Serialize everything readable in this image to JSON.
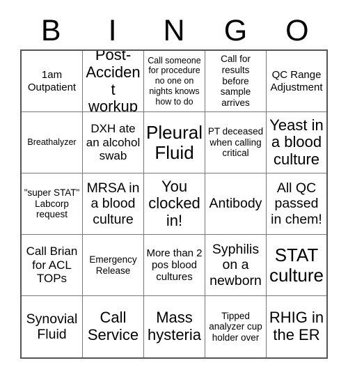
{
  "card": {
    "header_letters": [
      "B",
      "I",
      "N",
      "G",
      "O"
    ],
    "rows": [
      [
        {
          "text": "1am Outpatient",
          "size": "s"
        },
        {
          "text": "Post-Accident workup",
          "size": "xl"
        },
        {
          "text": "Call someone for procedure no one on nights knows how to do",
          "size": "xxs"
        },
        {
          "text": "Call for results before sample arrives",
          "size": "xs"
        },
        {
          "text": "QC Range Adjustment",
          "size": "s"
        }
      ],
      [
        {
          "text": "Breathalyzer",
          "size": "xxs"
        },
        {
          "text": "DXH ate an alcohol swab",
          "size": "m"
        },
        {
          "text": "Pleural Fluid",
          "size": "xxl"
        },
        {
          "text": "PT deceased when calling critical",
          "size": "xs"
        },
        {
          "text": "Yeast in a blood culture",
          "size": "xl"
        }
      ],
      [
        {
          "text": "\"super STAT\" Labcorp request",
          "size": "xs"
        },
        {
          "text": "MRSA in a blood culture",
          "size": "l"
        },
        {
          "text": "You clocked in!",
          "size": "xl"
        },
        {
          "text": "Antibody",
          "size": "l"
        },
        {
          "text": "All QC passed in chem!",
          "size": "l"
        }
      ],
      [
        {
          "text": "Call Brian for ACL TOPs",
          "size": "m"
        },
        {
          "text": "Emergency Release",
          "size": "xs"
        },
        {
          "text": "More than 2 pos blood cultures",
          "size": "s"
        },
        {
          "text": "Syphilis on a newborn",
          "size": "l"
        },
        {
          "text": "STAT culture",
          "size": "xxl"
        }
      ],
      [
        {
          "text": "Synovial Fluid",
          "size": "l"
        },
        {
          "text": "Call Service",
          "size": "xl"
        },
        {
          "text": "Mass hysteria",
          "size": "xl"
        },
        {
          "text": "Tipped analyzer cup holder over",
          "size": "xs"
        },
        {
          "text": "RHIG in the ER",
          "size": "xl"
        }
      ]
    ]
  },
  "colors": {
    "background": "#ffffff",
    "text": "#000000",
    "grid_line": "#777777",
    "grid_outer": "#555555"
  }
}
